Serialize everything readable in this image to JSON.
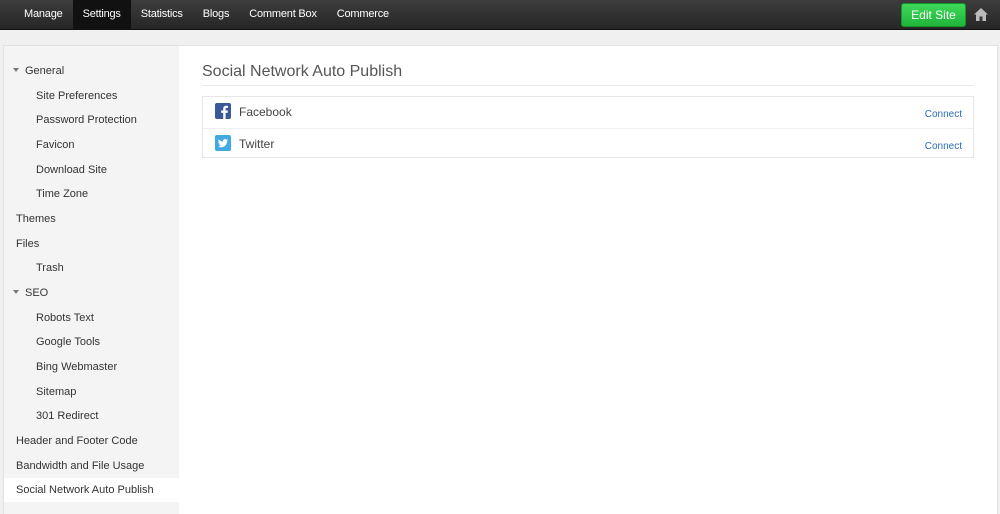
{
  "topnav": {
    "items": [
      "Manage",
      "Settings",
      "Statistics",
      "Blogs",
      "Comment Box",
      "Commerce"
    ],
    "active": "Settings",
    "edit_site_label": "Edit Site"
  },
  "sidebar": {
    "items": [
      {
        "label": "General",
        "level": "section",
        "expanded": true
      },
      {
        "label": "Site Preferences",
        "level": "sub"
      },
      {
        "label": "Password Protection",
        "level": "sub"
      },
      {
        "label": "Favicon",
        "level": "sub"
      },
      {
        "label": "Download Site",
        "level": "sub"
      },
      {
        "label": "Time Zone",
        "level": "sub"
      },
      {
        "label": "Themes",
        "level": "top"
      },
      {
        "label": "Files",
        "level": "top"
      },
      {
        "label": "Trash",
        "level": "sub"
      },
      {
        "label": "SEO",
        "level": "section",
        "expanded": true
      },
      {
        "label": "Robots Text",
        "level": "sub"
      },
      {
        "label": "Google Tools",
        "level": "sub"
      },
      {
        "label": "Bing Webmaster",
        "level": "sub"
      },
      {
        "label": "Sitemap",
        "level": "sub"
      },
      {
        "label": "301 Redirect",
        "level": "sub"
      },
      {
        "label": "Header and Footer Code",
        "level": "top"
      },
      {
        "label": "Bandwidth and File Usage",
        "level": "top"
      },
      {
        "label": "Social Network Auto Publish",
        "level": "top",
        "active": true
      }
    ]
  },
  "main": {
    "title": "Social Network Auto Publish",
    "networks": [
      {
        "name": "Facebook",
        "icon": "facebook-icon",
        "color": "#3b5998",
        "action": "Connect"
      },
      {
        "name": "Twitter",
        "icon": "twitter-icon",
        "color": "#41abe1",
        "action": "Connect"
      }
    ]
  },
  "colors": {
    "accent_green": "#2ec84a",
    "link_blue": "#2a6db5",
    "topbar": "#2e2e2e"
  }
}
